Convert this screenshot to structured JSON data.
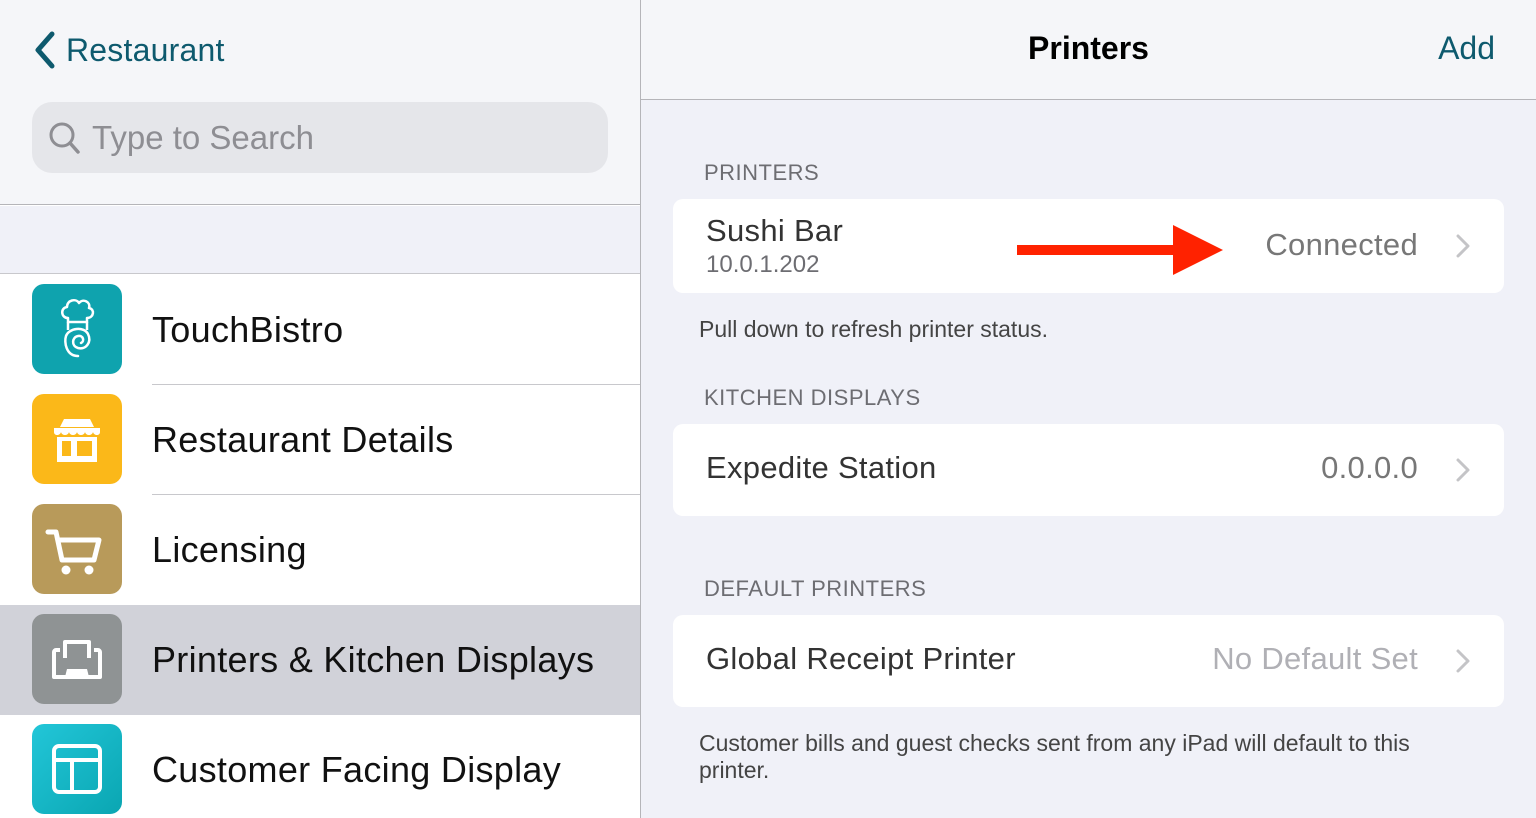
{
  "sidebar": {
    "back_label": "Restaurant",
    "search": {
      "placeholder": "Type to Search",
      "value": ""
    },
    "items": [
      {
        "label": "TouchBistro",
        "icon": "chef-spiral-icon",
        "color": "#0fa3ae",
        "selected": false
      },
      {
        "label": "Restaurant Details",
        "icon": "storefront-icon",
        "color": "#fbb819",
        "selected": false
      },
      {
        "label": "Licensing",
        "icon": "shopping-cart-icon",
        "color": "#b89a5a",
        "selected": false
      },
      {
        "label": "Printers & Kitchen Displays",
        "icon": "printer-icon",
        "color": "#8f9394",
        "selected": true
      },
      {
        "label": "Customer Facing Display",
        "icon": "layout-panel-icon",
        "color": "#19b8c8",
        "selected": false
      }
    ]
  },
  "nav": {
    "title": "Printers",
    "add_label": "Add"
  },
  "sections": {
    "printers": {
      "header": "PRINTERS",
      "rows": [
        {
          "title": "Sushi Bar",
          "subtitle": "10.0.1.202",
          "value": "Connected"
        }
      ],
      "footer": "Pull down to refresh printer status."
    },
    "kitchen_displays": {
      "header": "KITCHEN DISPLAYS",
      "rows": [
        {
          "title": "Expedite Station",
          "value": "0.0.0.0"
        }
      ]
    },
    "default_printers": {
      "header": "DEFAULT PRINTERS",
      "rows": [
        {
          "title": "Global Receipt Printer",
          "value": "No Default Set"
        }
      ],
      "footer": "Customer bills and guest checks sent from any iPad will default to this printer."
    }
  },
  "annotation": {
    "type": "arrow",
    "color": "#ff2200",
    "points_to": "Connected"
  },
  "colors": {
    "accent": "#0e5a6e",
    "selected_row": "#d1d2d9",
    "grouped_bg": "#f0f1f8"
  }
}
